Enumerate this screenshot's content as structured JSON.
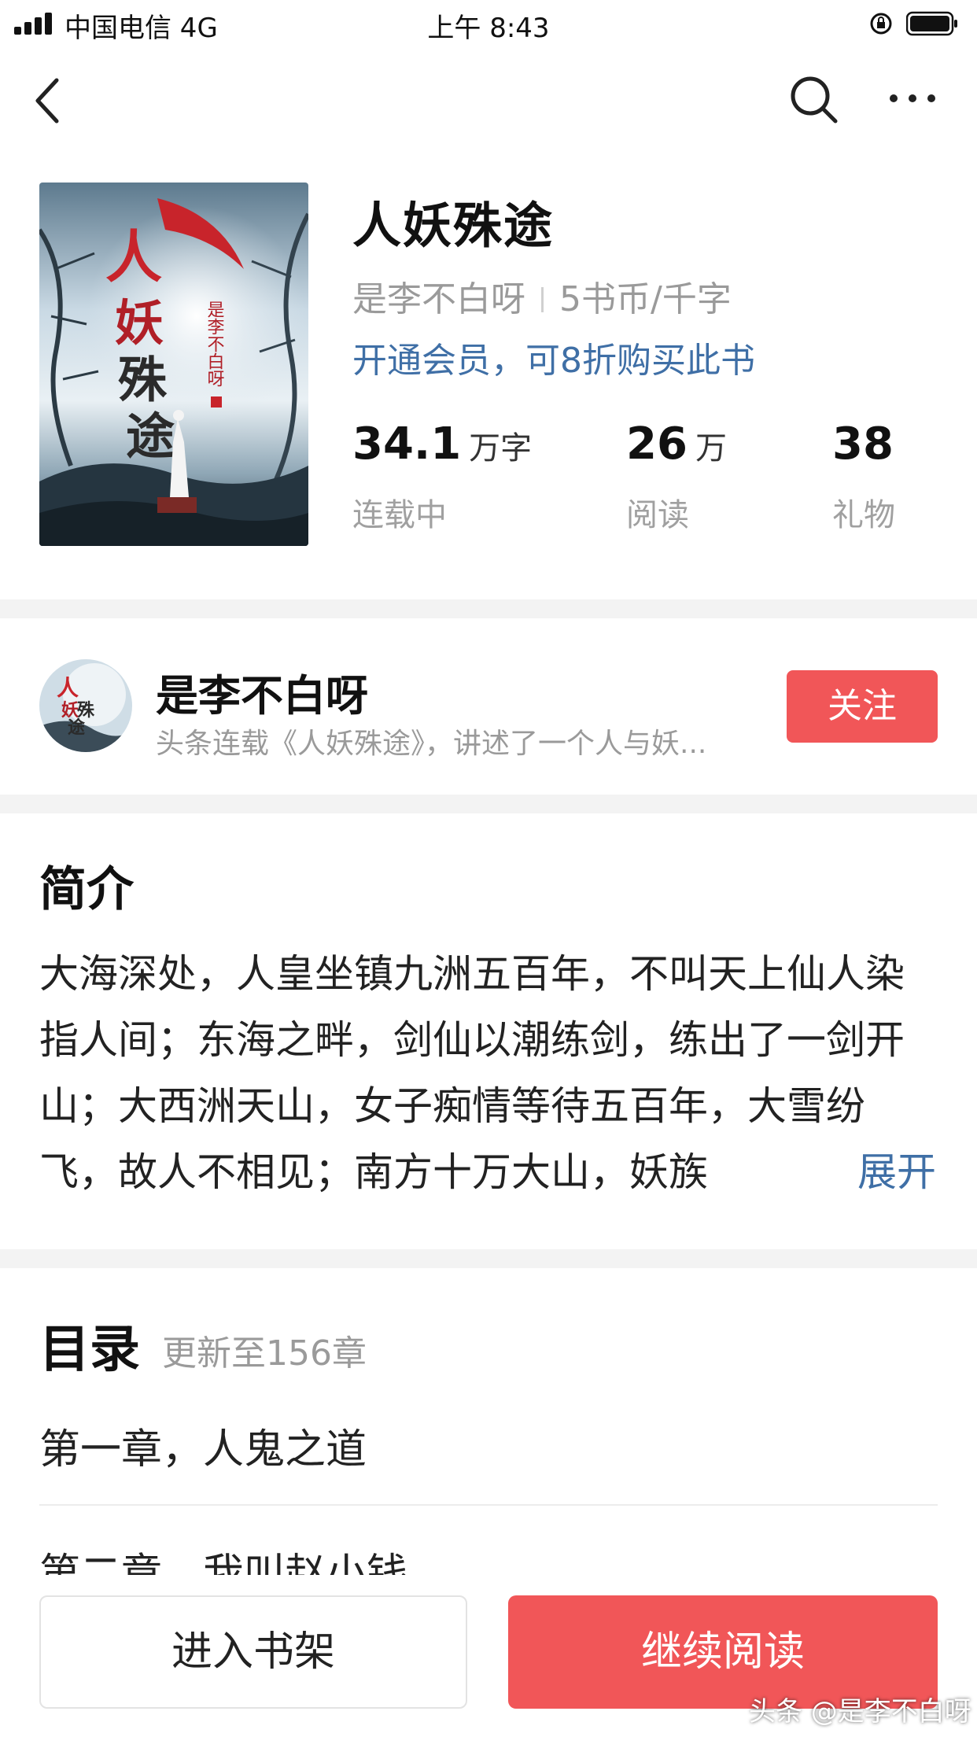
{
  "status_bar": {
    "carrier": "中国电信 4G",
    "time": "上午 8:43"
  },
  "book": {
    "title": "人妖殊途",
    "author": "是李不白呀",
    "price": "5书币/千字",
    "vip_offer": "开通会员，可8折购买此书",
    "cover_title": "人妖殊途",
    "cover_author": "是李不白呀"
  },
  "stats": [
    {
      "value": "34.1",
      "unit": "万字",
      "label": "连载中"
    },
    {
      "value": "26",
      "unit": "万",
      "label": "阅读"
    },
    {
      "value": "38",
      "unit": "",
      "label": "礼物"
    }
  ],
  "author_card": {
    "name": "是李不白呀",
    "description": "头条连载《人妖殊途》，讲述了一个人与妖...",
    "follow_label": "关注"
  },
  "intro": {
    "heading": "简介",
    "text": "大海深处，人皇坐镇九洲五百年，不叫天上仙人染指人间；东海之畔，剑仙以潮练剑，练出了一剑开山；大西洲天山，女子痴情等待五百年，大雪纷飞，故人不相见；南方十万大山，妖族",
    "expand_label": "展开"
  },
  "catalog": {
    "heading": "目录",
    "update_info": "更新至156章",
    "chapters": [
      "第一章，人鬼之道",
      "第二章，我叫赵小钱"
    ]
  },
  "bottom": {
    "shelf_label": "进入书架",
    "continue_label": "继续阅读",
    "watermark": "头条 @是李不白呀"
  },
  "colors": {
    "accent_red": "#f15658",
    "link_blue": "#3f6fa6"
  }
}
